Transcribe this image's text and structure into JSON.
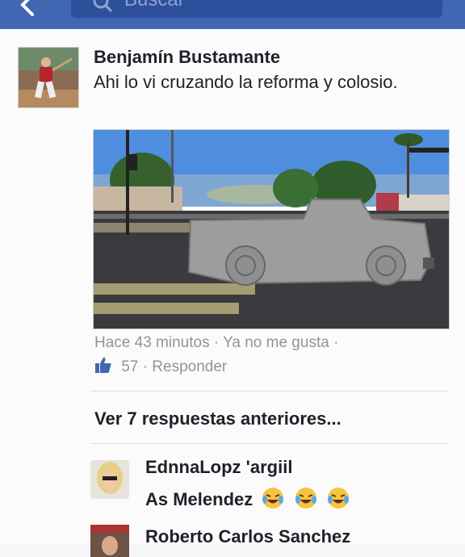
{
  "header": {
    "search_placeholder": "Buscar",
    "back_icon": "chevron-left-icon",
    "search_icon": "search-icon",
    "bar_color": "#4267b2"
  },
  "post": {
    "author": "Benjamín Bustamante",
    "text": "Ahi lo vi cruzando la reforma y colosio.",
    "meta": "Hace 43 minutos · Ya no me gusta ·",
    "likes_count": "57",
    "reply_label": "· Responder"
  },
  "replies": {
    "previous_label": "Ver 7 respuestas anteriores...",
    "items": [
      {
        "name": "EdnnaLopz 'argiil",
        "text": "As Melendez",
        "emoji_icon": "laughing-tears-emoji"
      },
      {
        "name": "Roberto Carlos Sanchez"
      }
    ]
  }
}
